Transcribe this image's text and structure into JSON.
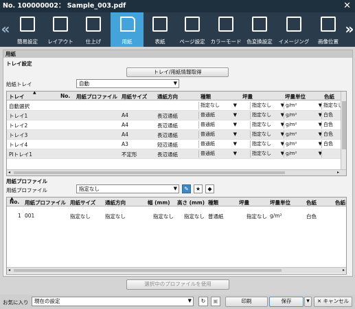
{
  "window": {
    "title": "No. 100000002： Sample_003.pdf",
    "close": "✕"
  },
  "toolbar": {
    "left_arrow": "«",
    "right_arrow": "»",
    "items": [
      {
        "label": "簡易設定",
        "icon": "quick-settings-icon"
      },
      {
        "label": "レイアウト",
        "icon": "layout-icon"
      },
      {
        "label": "仕上げ",
        "icon": "finishing-icon"
      },
      {
        "label": "用紙",
        "icon": "paper-icon",
        "active": true
      },
      {
        "label": "表紙",
        "icon": "cover-icon"
      },
      {
        "label": "ページ設定",
        "icon": "page-settings-icon"
      },
      {
        "label": "カラーモード",
        "icon": "color-mode-icon"
      },
      {
        "label": "色変換設定",
        "icon": "color-conversion-icon"
      },
      {
        "label": "イメージング",
        "icon": "imaging-icon"
      },
      {
        "label": "画像位置",
        "icon": "image-position-icon"
      }
    ]
  },
  "paper": {
    "section_title": "用紙",
    "tray_settings_title": "トレイ設定",
    "get_tray_info_button": "トレイ/用紙情報取得",
    "feed_tray_label": "給紙トレイ",
    "feed_tray_value": "自動",
    "tray_table": {
      "headers": [
        "トレイ",
        "No.",
        "用紙プロファイル",
        "用紙サイズ",
        "通紙方向",
        "種類",
        "坪量",
        "坪量単位",
        "色紙"
      ],
      "rows": [
        {
          "tray": "自動選択",
          "no": "",
          "profile": "",
          "size": "",
          "direction": "",
          "type": "指定なし",
          "weight": "指定なし",
          "unit": "g/m²",
          "color": "指定なし"
        },
        {
          "tray": "トレイ1",
          "no": "",
          "profile": "",
          "size": "A4",
          "direction": "長辺通紙",
          "type": "普通紙",
          "weight": "指定なし",
          "unit": "g/m²",
          "color": "白色"
        },
        {
          "tray": "トレイ2",
          "no": "",
          "profile": "",
          "size": "A4",
          "direction": "長辺通紙",
          "type": "普通紙",
          "weight": "指定なし",
          "unit": "g/m²",
          "color": "白色"
        },
        {
          "tray": "トレイ3",
          "no": "",
          "profile": "",
          "size": "A4",
          "direction": "長辺通紙",
          "type": "普通紙",
          "weight": "指定なし",
          "unit": "g/m²",
          "color": "白色"
        },
        {
          "tray": "トレイ4",
          "no": "",
          "profile": "",
          "size": "A3",
          "direction": "短辺通紙",
          "type": "普通紙",
          "weight": "指定なし",
          "unit": "g/m²",
          "color": "白色"
        },
        {
          "tray": "PIトレイ1",
          "no": "",
          "profile": "",
          "size": "不定形",
          "direction": "長辺通紙",
          "type": "普通紙",
          "weight": "指定なし",
          "unit": "g/m²",
          "color": ""
        }
      ]
    }
  },
  "profile": {
    "section_title": "用紙プロファイル",
    "label": "用紙プロファイル",
    "value": "指定なし",
    "table": {
      "headers": [
        "No.",
        "用紙プロファイル",
        "用紙サイズ",
        "通紙方向",
        "幅 (mm)",
        "高さ (mm)",
        "種類",
        "坪量",
        "坪量単位",
        "色紙",
        "色紙名"
      ],
      "rows": [
        {
          "no": "1",
          "profile": "001",
          "size": "指定なし",
          "direction": "指定なし",
          "width": "指定なし",
          "height": "指定なし",
          "type": "普通紙",
          "weight": "指定なし",
          "unit": "g/m²",
          "color": "白色",
          "color_name": ""
        }
      ]
    },
    "use_button": "選択中のプロファイルを使用"
  },
  "footer": {
    "favorites_label": "お気に入り",
    "favorites_value": "現在の設定",
    "print_button": "印刷",
    "save_button": "保存",
    "cancel_button": "キャンセル"
  },
  "colors": {
    "titlebar": "#1e2f3e",
    "toolbar": "#2a3b4c",
    "active_tab": "#45a3dc",
    "accent_icon": "#3f86c5"
  }
}
